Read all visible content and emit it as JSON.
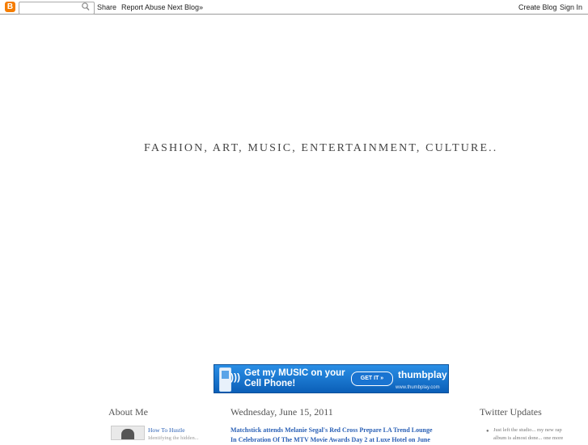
{
  "navbar": {
    "logo_letter": "B",
    "search_placeholder": "",
    "share": "Share",
    "report_abuse": "Report Abuse",
    "next_blog": "Next Blog»",
    "create_blog": "Create Blog",
    "sign_in": "Sign In"
  },
  "header": {
    "tagline": "FASHION, ART, MUSIC, ENTERTAINMENT, CULTURE.."
  },
  "ad": {
    "line1": "Get my MUSIC on your",
    "line2": "Cell Phone!",
    "cta": "GET IT »",
    "brand": "thumbplay",
    "url": "www.thumbplay.com"
  },
  "sidebar_left": {
    "title": "About Me",
    "profile_link": "How To Hustle",
    "blurb": "Identifying the hidden..."
  },
  "main": {
    "date": "Wednesday, June 15, 2011",
    "post_title_line1": "Matchstick attends Melanie Segal's Red Cross Prepare LA Trend Lounge",
    "post_title_line2": "In Celebration Of The MTV Movie Awards Day 2 at Luxe Hotel on June"
  },
  "sidebar_right": {
    "title": "Twitter Updates",
    "tweet_line1": "Just left the studio... my new rap",
    "tweet_line2": "album is almost done... one more"
  },
  "colors": {
    "link": "#2b61b6",
    "heading": "#555555",
    "blogger_orange": "#f57d00",
    "ad_blue": "#1a74d1"
  }
}
